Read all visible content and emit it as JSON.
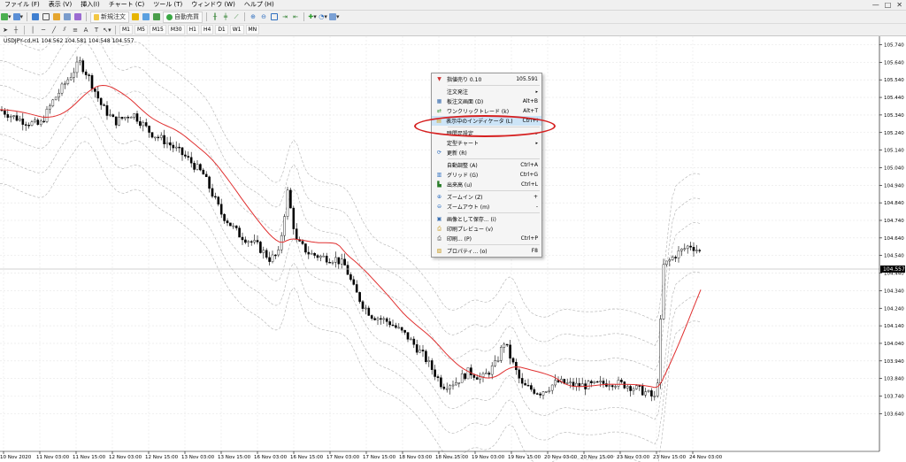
{
  "menubar": {
    "items": [
      "ファイル (F)",
      "表示 (V)",
      "挿入(I)",
      "チャート (C)",
      "ツール (T)",
      "ウィンドウ (W)",
      "ヘルプ (H)"
    ],
    "window_controls": [
      "—",
      "□",
      "✕"
    ]
  },
  "toolbar": {
    "new_order_label": "新規注文",
    "autotrade_label": "自動売買",
    "timeframes": [
      "M1",
      "M5",
      "M15",
      "M30",
      "H1",
      "H4",
      "D1",
      "W1",
      "MN"
    ]
  },
  "chart": {
    "symbol_label": "USDJPY-cd,H1  104.562 104.581 104.548 104.557",
    "current_price": "104.557",
    "price_axis": [
      "105.740",
      "105.640",
      "105.540",
      "105.440",
      "105.340",
      "105.240",
      "105.140",
      "105.040",
      "104.940",
      "104.840",
      "104.740",
      "104.640",
      "104.540",
      "104.440",
      "104.340",
      "104.240",
      "104.140",
      "104.040",
      "103.940",
      "103.840",
      "103.740",
      "103.640"
    ],
    "time_axis": [
      "10 Nov 2020",
      "11 Nov 03:00",
      "11 Nov 15:00",
      "12 Nov 03:00",
      "12 Nov 15:00",
      "13 Nov 03:00",
      "13 Nov 15:00",
      "16 Nov 03:00",
      "16 Nov 15:00",
      "17 Nov 03:00",
      "17 Nov 15:00",
      "18 Nov 03:00",
      "18 Nov 15:00",
      "19 Nov 03:00",
      "19 Nov 15:00",
      "20 Nov 03:00",
      "20 Nov 15:00",
      "23 Nov 03:00",
      "23 Nov 15:00",
      "24 Nov 03:00"
    ],
    "ma_color": "#e03030",
    "band_color": "#b0b0b0"
  },
  "context_menu": {
    "items": [
      {
        "label": "指値売り 0.10",
        "shortcut": "105.591",
        "icon": "sell-arrow-icon",
        "submenu": false
      },
      {
        "sep": true
      },
      {
        "label": "注文発注",
        "shortcut": "",
        "icon": "",
        "submenu": true
      },
      {
        "label": "板注文画面 (D)",
        "shortcut": "Alt+B",
        "icon": "depth-of-market-icon",
        "submenu": false
      },
      {
        "label": "ワンクリックトレード (k)",
        "shortcut": "Alt+T",
        "icon": "one-click-trading-icon",
        "submenu": false
      },
      {
        "label": "表示中のインディケータ (L)",
        "shortcut": "Ctrl+I",
        "icon": "indicators-list-icon",
        "submenu": false,
        "highlight": true
      },
      {
        "sep": true
      },
      {
        "label": "時間足設定",
        "shortcut": "",
        "icon": "",
        "submenu": true
      },
      {
        "label": "定型チャート",
        "shortcut": "",
        "icon": "",
        "submenu": true
      },
      {
        "label": "更新 (R)",
        "shortcut": "",
        "icon": "refresh-icon",
        "submenu": false
      },
      {
        "sep": true
      },
      {
        "label": "自動調整 (A)",
        "shortcut": "Ctrl+A",
        "icon": "",
        "submenu": false
      },
      {
        "label": "グリッド (G)",
        "shortcut": "Ctrl+G",
        "icon": "grid-icon",
        "submenu": false
      },
      {
        "label": "出来高 (u)",
        "shortcut": "Ctrl+L",
        "icon": "volumes-icon",
        "submenu": false
      },
      {
        "sep": true
      },
      {
        "label": "ズームイン (Z)",
        "shortcut": "+",
        "icon": "zoom-in-icon",
        "submenu": false
      },
      {
        "label": "ズームアウト (m)",
        "shortcut": "-",
        "icon": "zoom-out-icon",
        "submenu": false
      },
      {
        "sep": true
      },
      {
        "label": "画像として保存... (i)",
        "shortcut": "",
        "icon": "save-image-icon",
        "submenu": false
      },
      {
        "label": "印刷プレビュー (v)",
        "shortcut": "",
        "icon": "print-preview-icon",
        "submenu": false
      },
      {
        "label": "印刷... (P)",
        "shortcut": "Ctrl+P",
        "icon": "print-icon",
        "submenu": false
      },
      {
        "sep": true
      },
      {
        "label": "プロパティ... (o)",
        "shortcut": "F8",
        "icon": "properties-icon",
        "submenu": false
      }
    ]
  }
}
